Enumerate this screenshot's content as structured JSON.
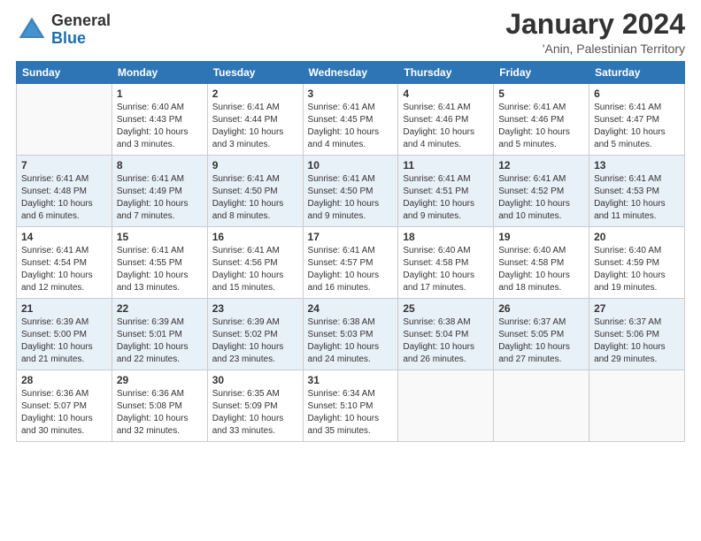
{
  "header": {
    "logo_general": "General",
    "logo_blue": "Blue",
    "month_title": "January 2024",
    "location": "'Anin, Palestinian Territory"
  },
  "weekdays": [
    "Sunday",
    "Monday",
    "Tuesday",
    "Wednesday",
    "Thursday",
    "Friday",
    "Saturday"
  ],
  "weeks": [
    [
      {
        "day": "",
        "detail": ""
      },
      {
        "day": "1",
        "detail": "Sunrise: 6:40 AM\nSunset: 4:43 PM\nDaylight: 10 hours\nand 3 minutes."
      },
      {
        "day": "2",
        "detail": "Sunrise: 6:41 AM\nSunset: 4:44 PM\nDaylight: 10 hours\nand 3 minutes."
      },
      {
        "day": "3",
        "detail": "Sunrise: 6:41 AM\nSunset: 4:45 PM\nDaylight: 10 hours\nand 4 minutes."
      },
      {
        "day": "4",
        "detail": "Sunrise: 6:41 AM\nSunset: 4:46 PM\nDaylight: 10 hours\nand 4 minutes."
      },
      {
        "day": "5",
        "detail": "Sunrise: 6:41 AM\nSunset: 4:46 PM\nDaylight: 10 hours\nand 5 minutes."
      },
      {
        "day": "6",
        "detail": "Sunrise: 6:41 AM\nSunset: 4:47 PM\nDaylight: 10 hours\nand 5 minutes."
      }
    ],
    [
      {
        "day": "7",
        "detail": "Sunrise: 6:41 AM\nSunset: 4:48 PM\nDaylight: 10 hours\nand 6 minutes."
      },
      {
        "day": "8",
        "detail": "Sunrise: 6:41 AM\nSunset: 4:49 PM\nDaylight: 10 hours\nand 7 minutes."
      },
      {
        "day": "9",
        "detail": "Sunrise: 6:41 AM\nSunset: 4:50 PM\nDaylight: 10 hours\nand 8 minutes."
      },
      {
        "day": "10",
        "detail": "Sunrise: 6:41 AM\nSunset: 4:50 PM\nDaylight: 10 hours\nand 9 minutes."
      },
      {
        "day": "11",
        "detail": "Sunrise: 6:41 AM\nSunset: 4:51 PM\nDaylight: 10 hours\nand 9 minutes."
      },
      {
        "day": "12",
        "detail": "Sunrise: 6:41 AM\nSunset: 4:52 PM\nDaylight: 10 hours\nand 10 minutes."
      },
      {
        "day": "13",
        "detail": "Sunrise: 6:41 AM\nSunset: 4:53 PM\nDaylight: 10 hours\nand 11 minutes."
      }
    ],
    [
      {
        "day": "14",
        "detail": "Sunrise: 6:41 AM\nSunset: 4:54 PM\nDaylight: 10 hours\nand 12 minutes."
      },
      {
        "day": "15",
        "detail": "Sunrise: 6:41 AM\nSunset: 4:55 PM\nDaylight: 10 hours\nand 13 minutes."
      },
      {
        "day": "16",
        "detail": "Sunrise: 6:41 AM\nSunset: 4:56 PM\nDaylight: 10 hours\nand 15 minutes."
      },
      {
        "day": "17",
        "detail": "Sunrise: 6:41 AM\nSunset: 4:57 PM\nDaylight: 10 hours\nand 16 minutes."
      },
      {
        "day": "18",
        "detail": "Sunrise: 6:40 AM\nSunset: 4:58 PM\nDaylight: 10 hours\nand 17 minutes."
      },
      {
        "day": "19",
        "detail": "Sunrise: 6:40 AM\nSunset: 4:58 PM\nDaylight: 10 hours\nand 18 minutes."
      },
      {
        "day": "20",
        "detail": "Sunrise: 6:40 AM\nSunset: 4:59 PM\nDaylight: 10 hours\nand 19 minutes."
      }
    ],
    [
      {
        "day": "21",
        "detail": "Sunrise: 6:39 AM\nSunset: 5:00 PM\nDaylight: 10 hours\nand 21 minutes."
      },
      {
        "day": "22",
        "detail": "Sunrise: 6:39 AM\nSunset: 5:01 PM\nDaylight: 10 hours\nand 22 minutes."
      },
      {
        "day": "23",
        "detail": "Sunrise: 6:39 AM\nSunset: 5:02 PM\nDaylight: 10 hours\nand 23 minutes."
      },
      {
        "day": "24",
        "detail": "Sunrise: 6:38 AM\nSunset: 5:03 PM\nDaylight: 10 hours\nand 24 minutes."
      },
      {
        "day": "25",
        "detail": "Sunrise: 6:38 AM\nSunset: 5:04 PM\nDaylight: 10 hours\nand 26 minutes."
      },
      {
        "day": "26",
        "detail": "Sunrise: 6:37 AM\nSunset: 5:05 PM\nDaylight: 10 hours\nand 27 minutes."
      },
      {
        "day": "27",
        "detail": "Sunrise: 6:37 AM\nSunset: 5:06 PM\nDaylight: 10 hours\nand 29 minutes."
      }
    ],
    [
      {
        "day": "28",
        "detail": "Sunrise: 6:36 AM\nSunset: 5:07 PM\nDaylight: 10 hours\nand 30 minutes."
      },
      {
        "day": "29",
        "detail": "Sunrise: 6:36 AM\nSunset: 5:08 PM\nDaylight: 10 hours\nand 32 minutes."
      },
      {
        "day": "30",
        "detail": "Sunrise: 6:35 AM\nSunset: 5:09 PM\nDaylight: 10 hours\nand 33 minutes."
      },
      {
        "day": "31",
        "detail": "Sunrise: 6:34 AM\nSunset: 5:10 PM\nDaylight: 10 hours\nand 35 minutes."
      },
      {
        "day": "",
        "detail": ""
      },
      {
        "day": "",
        "detail": ""
      },
      {
        "day": "",
        "detail": ""
      }
    ]
  ]
}
